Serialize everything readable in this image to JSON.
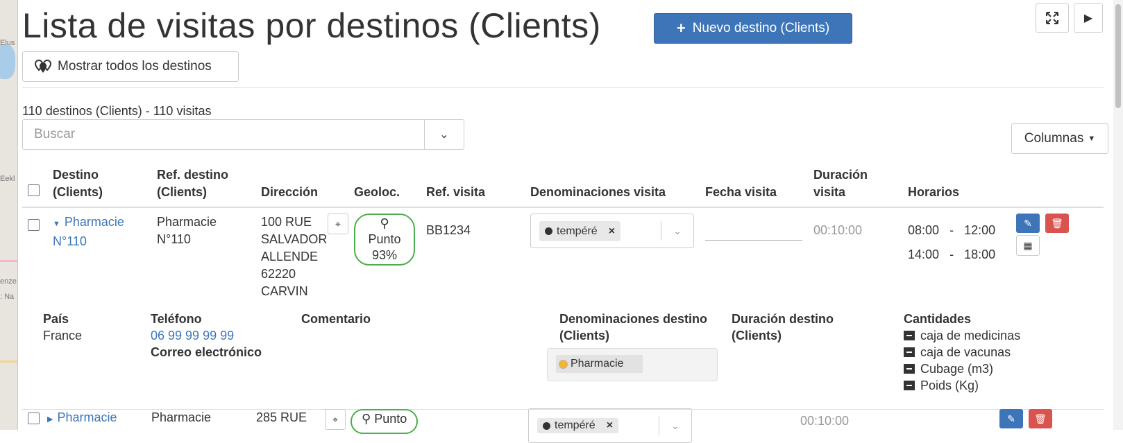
{
  "page": {
    "title": "Lista de visitas por destinos (Clients)",
    "new_button": "Nuevo destino (Clients)",
    "show_all_button": "Mostrar todos los destinos",
    "summary": "110 destinos (Clients) - 110 visitas",
    "search_placeholder": "Buscar",
    "columns_button": "Columnas"
  },
  "table": {
    "headers": {
      "destination": "Destino (Clients)",
      "destination_ref": "Ref. destino (Clients)",
      "address": "Dirección",
      "geoloc": "Geoloc.",
      "visit_ref": "Ref. visita",
      "visit_tags": "Denominaciones visita",
      "visit_date": "Fecha visita",
      "visit_duration": "Duración visita",
      "schedules": "Horarios"
    },
    "rows": [
      {
        "destination": "Pharmacie N°110",
        "destination_ref": "Pharmacie N°110",
        "address": [
          "100 RUE",
          "SALVADOR",
          "ALLENDE",
          "62220",
          "CARVIN"
        ],
        "geoloc_label": "Punto",
        "geoloc_pct": "93%",
        "visit_ref": "BB1234",
        "tag": "tempéré",
        "duration": "00:10:00",
        "schedule": [
          {
            "start": "08:00",
            "sep": "-",
            "end": "12:00"
          },
          {
            "start": "14:00",
            "sep": "-",
            "end": "18:00"
          }
        ]
      },
      {
        "destination": "Pharmacie",
        "destination_ref": "Pharmacie",
        "address_first": "285 RUE",
        "geoloc_label": "Punto",
        "tag": "tempéré",
        "duration": "00:10:00"
      }
    ]
  },
  "detail": {
    "country_label": "País",
    "country": "France",
    "phone_label": "Teléfono",
    "phone": "06 99 99 99 99",
    "email_label": "Correo electrónico",
    "comment_label": "Comentario",
    "dest_tags_label": "Denominaciones destino (Clients)",
    "dest_tag": "Pharmacie",
    "dest_duration_label": "Duración destino (Clients)",
    "quantities_label": "Cantidades",
    "quantities": [
      "caja de medicinas",
      "caja de vacunas",
      "Cubage (m3)",
      "Poids (Kg)"
    ]
  },
  "icons": {
    "plus": "plus-icon",
    "markers": "map-markers-icon",
    "fullscreen": "fullscreen-icon",
    "next": "caret-right-icon",
    "edit": "edit-icon",
    "delete": "trash-icon",
    "calendar": "calendar-icon",
    "locate": "crosshair-icon",
    "box": "box-icon"
  },
  "colors": {
    "primary": "#3d75b8",
    "danger": "#d9534f",
    "geoloc_ok": "#4cae4c"
  }
}
